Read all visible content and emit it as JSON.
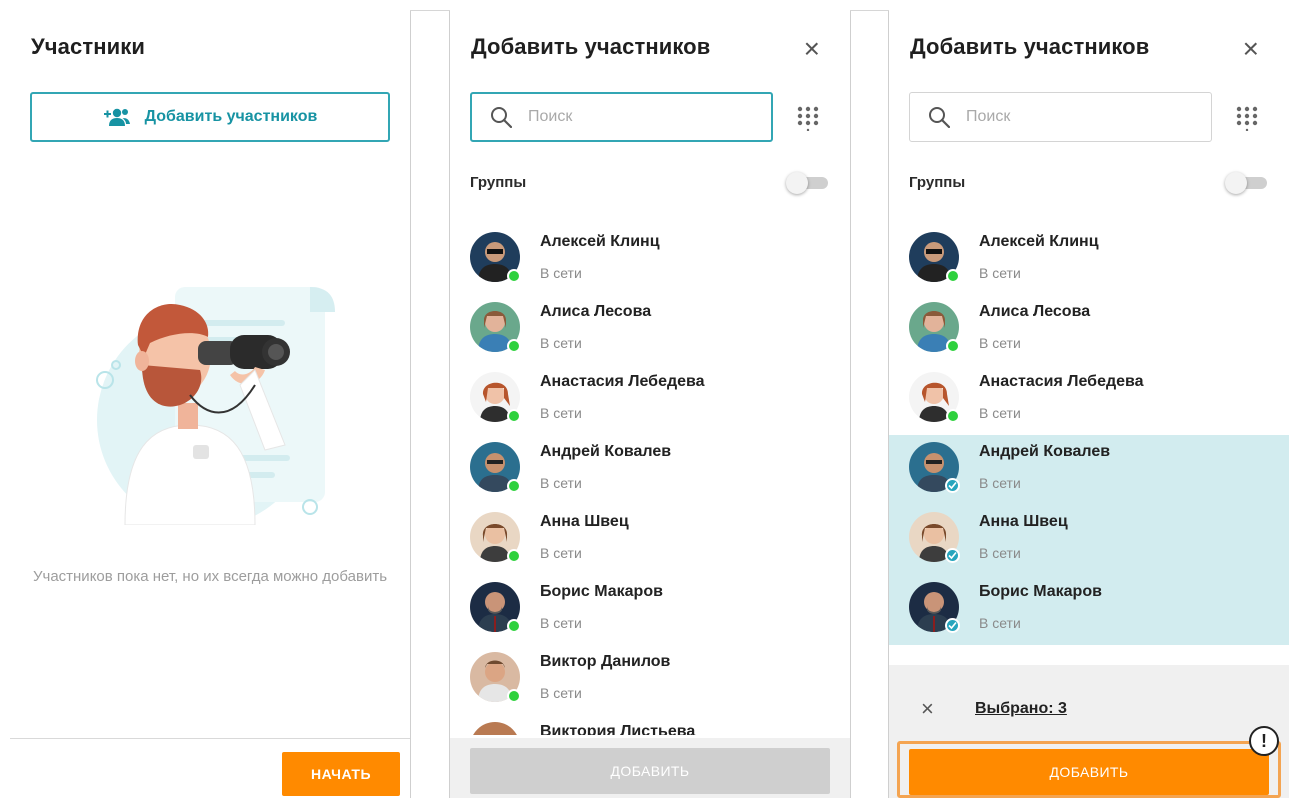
{
  "panel_empty": {
    "title": "Участники",
    "add_button_label": "Добавить участников",
    "empty_text": "Участников пока нет, но их всегда можно добавить",
    "start_button_label": "НАЧАТЬ"
  },
  "panel_add": {
    "title": "Добавить участников",
    "search_placeholder": "Поиск",
    "groups_label": "Группы",
    "add_button_label": "ДОБАВИТЬ"
  },
  "panel_selected": {
    "title": "Добавить участников",
    "search_placeholder": "Поиск",
    "groups_label": "Группы",
    "selected_label": "Выбрано: 3",
    "add_button_label": "ДОБАВИТЬ",
    "warning_marker": "!"
  },
  "contacts": [
    {
      "name": "Алексей Клинц",
      "status": "В сети"
    },
    {
      "name": "Алиса Лесова",
      "status": "В сети"
    },
    {
      "name": "Анастасия Лебедева",
      "status": "В сети"
    },
    {
      "name": "Андрей Ковалев",
      "status": "В сети"
    },
    {
      "name": "Анна Швец",
      "status": "В сети"
    },
    {
      "name": "Борис Макаров",
      "status": "В сети"
    },
    {
      "name": "Виктор Данилов",
      "status": "В сети"
    },
    {
      "name": "Виктория Листьева",
      "status": ""
    }
  ],
  "colors": {
    "accent_teal": "#32a6b4",
    "accent_orange": "#ff8a00",
    "online_green": "#2ed13d",
    "selected_row": "#d2ecef",
    "warning_outline": "#f4a451"
  },
  "icons": [
    "add-users-icon",
    "search-icon",
    "dialpad-icon",
    "close-icon",
    "check-icon",
    "warning-icon"
  ]
}
